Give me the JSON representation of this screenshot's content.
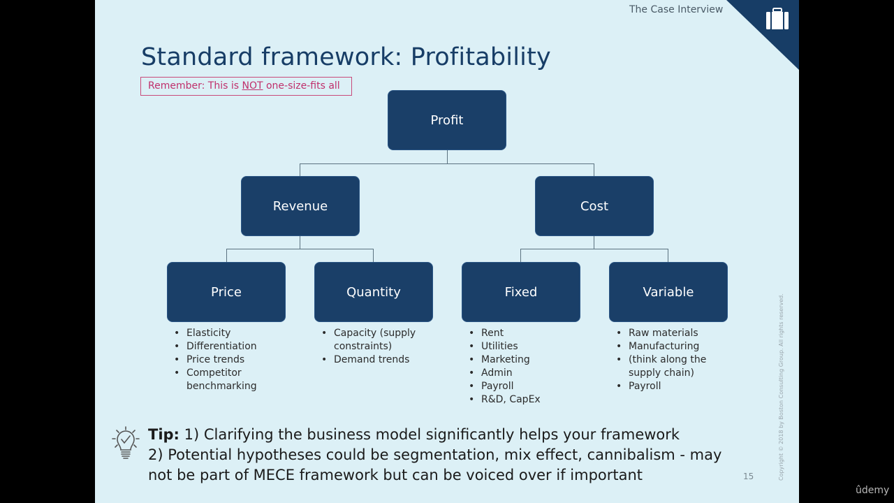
{
  "header": {
    "label": "The Case Interview",
    "icon": "briefcase-icon"
  },
  "title": "Standard framework: Profitability",
  "note": {
    "prefix": "Remember: This is ",
    "emphasis": "NOT",
    "suffix": " one-size-fits all"
  },
  "tree": {
    "root": "Profit",
    "level2": [
      "Revenue",
      "Cost"
    ],
    "level3": [
      {
        "label": "Price",
        "bullets": [
          "Elasticity",
          "Differentiation",
          "Price trends",
          "Competitor benchmarking"
        ]
      },
      {
        "label": "Quantity",
        "bullets": [
          "Capacity (supply constraints)",
          "Demand trends"
        ]
      },
      {
        "label": "Fixed",
        "bullets": [
          "Rent",
          "Utilities",
          "Marketing",
          "Admin",
          "Payroll",
          "R&D, CapEx"
        ]
      },
      {
        "label": "Variable",
        "bullets": [
          "Raw materials",
          "Manufacturing",
          "(think along the supply chain)",
          "Payroll"
        ]
      }
    ]
  },
  "tip": {
    "label": "Tip:",
    "line1": " 1) Clarifying the business model significantly helps your framework",
    "line2": "2) Potential hypotheses could be segmentation, mix effect, cannibalism - may not be part of MECE framework but can be voiced over if important",
    "icon": "lightbulb-icon"
  },
  "page_number": "15",
  "copyright": "Copyright © 2018 by Boston Consulting Group. All rights reserved.",
  "watermark": "ûdemy",
  "colors": {
    "box": "#1a3f68",
    "background": "#dcf0f6",
    "accent": "#c0306c"
  }
}
